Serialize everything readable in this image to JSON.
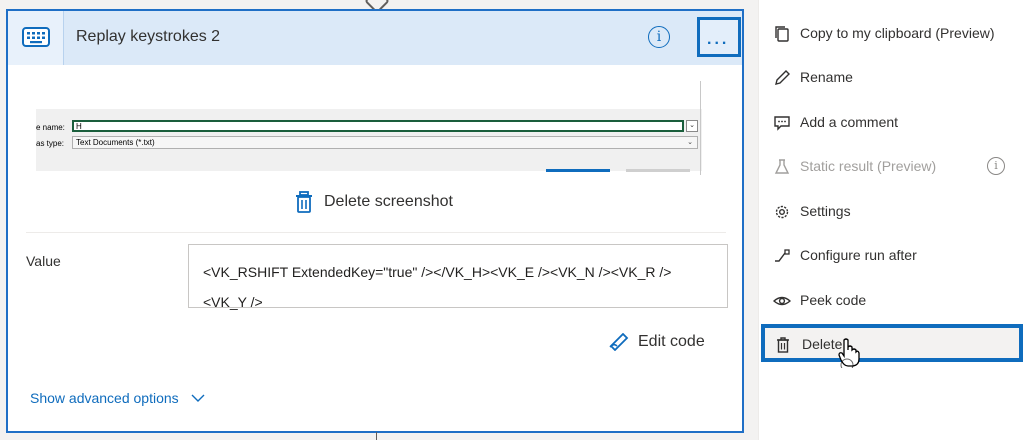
{
  "card": {
    "title": "Replay keystrokes 2",
    "info_glyph": "i",
    "more_label": "...",
    "screenshot": {
      "name_label": "e name:",
      "name_value": "H",
      "type_label": "as type:",
      "type_value": "Text Documents (*.txt)"
    },
    "delete_screenshot_label": "Delete screenshot",
    "value_label": "Value",
    "value_text": "<VK_RSHIFT ExtendedKey=\"true\" /></VK_H><VK_E /><VK_N /><VK_R /><VK_Y />",
    "edit_code_label": "Edit code",
    "advanced_options_label": "Show advanced options"
  },
  "menu": {
    "items": [
      {
        "label": "Copy to my clipboard (Preview)",
        "icon": "copy-icon",
        "disabled": false
      },
      {
        "label": "Rename",
        "icon": "pencil-icon",
        "disabled": false
      },
      {
        "label": "Add a comment",
        "icon": "comment-icon",
        "disabled": false
      },
      {
        "label": "Static result (Preview)",
        "icon": "beaker-icon",
        "disabled": true
      },
      {
        "label": "Settings",
        "icon": "gear-icon",
        "disabled": false
      },
      {
        "label": "Configure run after",
        "icon": "run-after-icon",
        "disabled": false
      },
      {
        "label": "Peek code",
        "icon": "eye-icon",
        "disabled": false
      },
      {
        "label": "Delete",
        "icon": "trash-icon",
        "disabled": false
      }
    ],
    "info_glyph": "i"
  },
  "colors": {
    "accent": "#0f6cbd",
    "header_bg": "#dbe9f8",
    "page_bg": "#f3f2f1"
  }
}
